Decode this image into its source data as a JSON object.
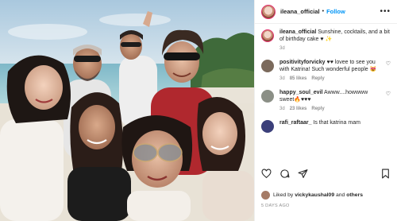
{
  "header": {
    "username": "ileana_official",
    "separator": "•",
    "follow_label": "Follow",
    "more_label": "•••"
  },
  "caption": {
    "username": "ileana_official",
    "text": "Sunshine, cocktails, and a bit of birthday cake ♥ ✨",
    "age": "3d"
  },
  "comments": [
    {
      "username": "positivityforvicky",
      "text": "♥♥ lovee to see you with Katrina! Such wonderful people 😻",
      "age": "3d",
      "likes": "85 likes",
      "reply": "Reply"
    },
    {
      "username": "happy_soul_evil",
      "text": "Awww....howwww sweet🔥♥♥♥",
      "age": "3d",
      "likes": "23 likes",
      "reply": "Reply"
    },
    {
      "username": "rafi_raftaar_",
      "text": "Is that katrina mam",
      "age": "",
      "likes": "",
      "reply": ""
    }
  ],
  "likes": {
    "prefix": "Liked by",
    "user": "vickykaushal09",
    "suffix": "and",
    "others": "others"
  },
  "date": "5 DAYS AGO",
  "colors": {
    "link": "#0095f6",
    "heart": "#ed4956",
    "text": "#262626",
    "muted": "#8e8e8e"
  }
}
